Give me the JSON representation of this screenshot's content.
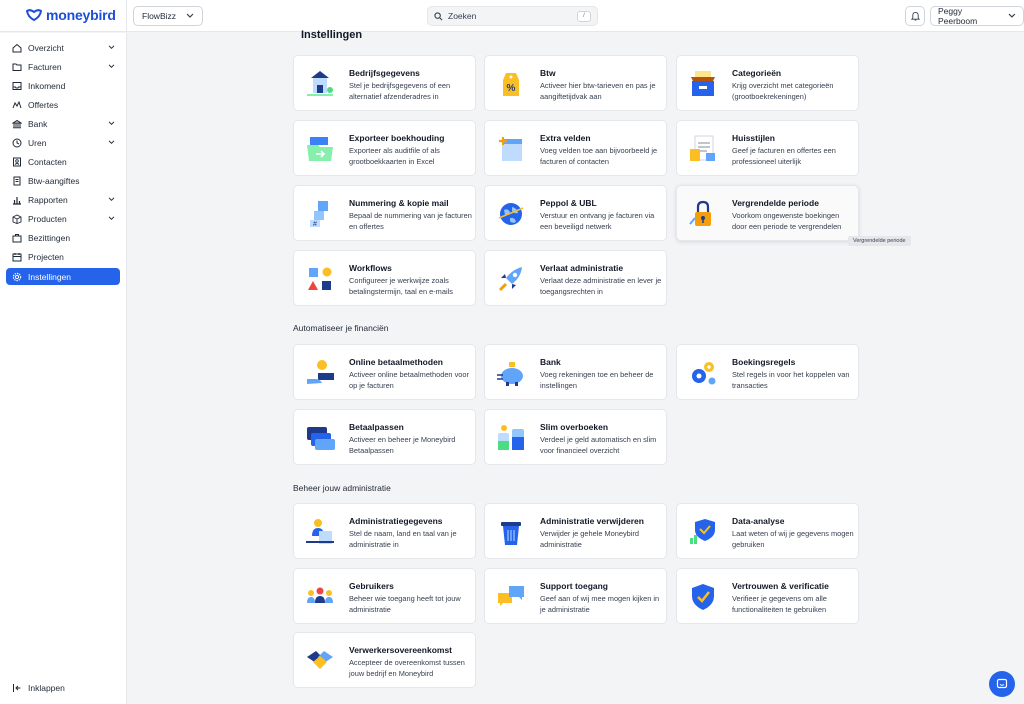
{
  "app": {
    "logo_text": "moneybird",
    "org": "FlowBizz",
    "user": "Peggy Peerboom"
  },
  "search": {
    "placeholder": "Zoeken",
    "shortcut": "/"
  },
  "sidebar": {
    "items": [
      {
        "label": "Overzicht",
        "icon": "home-icon",
        "chevron": true
      },
      {
        "label": "Facturen",
        "icon": "folder-icon",
        "chevron": true
      },
      {
        "label": "Inkomend",
        "icon": "inbox-icon",
        "chevron": false
      },
      {
        "label": "Offertes",
        "icon": "quote-icon",
        "chevron": false
      },
      {
        "label": "Bank",
        "icon": "bank-icon",
        "chevron": true
      },
      {
        "label": "Uren",
        "icon": "clock-icon",
        "chevron": true
      },
      {
        "label": "Contacten",
        "icon": "contacts-icon",
        "chevron": false
      },
      {
        "label": "Btw-aangiftes",
        "icon": "receipt-icon",
        "chevron": false
      },
      {
        "label": "Rapporten",
        "icon": "chart-icon",
        "chevron": true
      },
      {
        "label": "Producten",
        "icon": "box-icon",
        "chevron": true
      },
      {
        "label": "Bezittingen",
        "icon": "briefcase-icon",
        "chevron": false
      },
      {
        "label": "Projecten",
        "icon": "calendar-icon",
        "chevron": false
      },
      {
        "label": "Instellingen",
        "icon": "gear-icon",
        "chevron": false,
        "active": true
      }
    ],
    "collapse_label": "Inklappen"
  },
  "main": {
    "title": "Instellingen",
    "sections": [
      {
        "title": "Automatiseer je financiën"
      },
      {
        "title": "Beheer jouw administratie"
      }
    ],
    "cards": [
      {
        "title": "Bedrijfsgegevens",
        "desc": "Stel je bedrijfsgegevens of een alternatief afzenderadres in",
        "icon": "building-icon"
      },
      {
        "title": "Btw",
        "desc": "Activeer hier btw-tarieven en pas je aangiftetijdvak aan",
        "icon": "percent-tag-icon"
      },
      {
        "title": "Categorieën",
        "desc": "Krijg overzicht met categorieën (grootboekrekeningen)",
        "icon": "file-box-icon"
      },
      {
        "title": "Exporteer boekhouding",
        "desc": "Exporteer als auditfile of als grootboekkaarten in Excel",
        "icon": "export-folder-icon"
      },
      {
        "title": "Extra velden",
        "desc": "Voeg velden toe aan bijvoorbeeld je facturen of contacten",
        "icon": "fields-icon"
      },
      {
        "title": "Huisstijlen",
        "desc": "Geef je facturen en offertes een professioneel uiterlijk",
        "icon": "style-document-icon"
      },
      {
        "title": "Nummering & kopie mail",
        "desc": "Bepaal de nummering van je facturen en offertes",
        "icon": "numbering-icon"
      },
      {
        "title": "Peppol & UBL",
        "desc": "Verstuur en ontvang je facturen via een beveiligd netwerk",
        "icon": "globe-icon"
      },
      {
        "title": "Vergrendelde periode",
        "desc": "Voorkom ongewenste boekingen door een periode te vergrendelen",
        "icon": "lock-icon"
      },
      {
        "title": "Workflows",
        "desc": "Configureer je werkwijze zoals betalingstermijn, taal en e-mails",
        "icon": "shapes-icon"
      },
      {
        "title": "Verlaat administratie",
        "desc": "Verlaat deze administratie en lever je toegangsrechten in",
        "icon": "rocket-icon"
      },
      {
        "title": "Online betaalmethoden",
        "desc": "Activeer online betaalmethoden voor op je facturen",
        "icon": "payment-hand-icon"
      },
      {
        "title": "Bank",
        "desc": "Voeg rekeningen toe en beheer de instellingen",
        "icon": "piggy-bank-icon"
      },
      {
        "title": "Boekingsregels",
        "desc": "Stel regels in voor het koppelen van transacties",
        "icon": "gears-icon"
      },
      {
        "title": "Betaalpassen",
        "desc": "Activeer en beheer je Moneybird Betaalpassen",
        "icon": "cards-icon"
      },
      {
        "title": "Slim overboeken",
        "desc": "Verdeel je geld automatisch en slim voor financieel overzicht",
        "icon": "jars-icon"
      },
      {
        "title": "Administratiegegevens",
        "desc": "Stel de naam, land en taal van je administratie in",
        "icon": "person-desk-icon"
      },
      {
        "title": "Administratie verwijderen",
        "desc": "Verwijder je gehele Moneybird administratie",
        "icon": "trash-icon"
      },
      {
        "title": "Data-analyse",
        "desc": "Laat weten of wij je gegevens mogen gebruiken",
        "icon": "shield-chart-icon"
      },
      {
        "title": "Gebruikers",
        "desc": "Beheer wie toegang heeft tot jouw administratie",
        "icon": "users-icon"
      },
      {
        "title": "Support toegang",
        "desc": "Geef aan of wij mee mogen kijken in je administratie",
        "icon": "chat-bubbles-icon"
      },
      {
        "title": "Vertrouwen & verificatie",
        "desc": "Verifieer je gegevens om alle functionaliteiten te gebruiken",
        "icon": "shield-check-icon"
      },
      {
        "title": "Verwerkersovereenkomst",
        "desc": "Accepteer de overeenkomst tussen jouw bedrijf en Moneybird",
        "icon": "handshake-icon"
      }
    ]
  },
  "tooltip": "Vergrendelde periode",
  "colors": {
    "accent": "#2563eb",
    "brand": "#1d4ed8"
  }
}
